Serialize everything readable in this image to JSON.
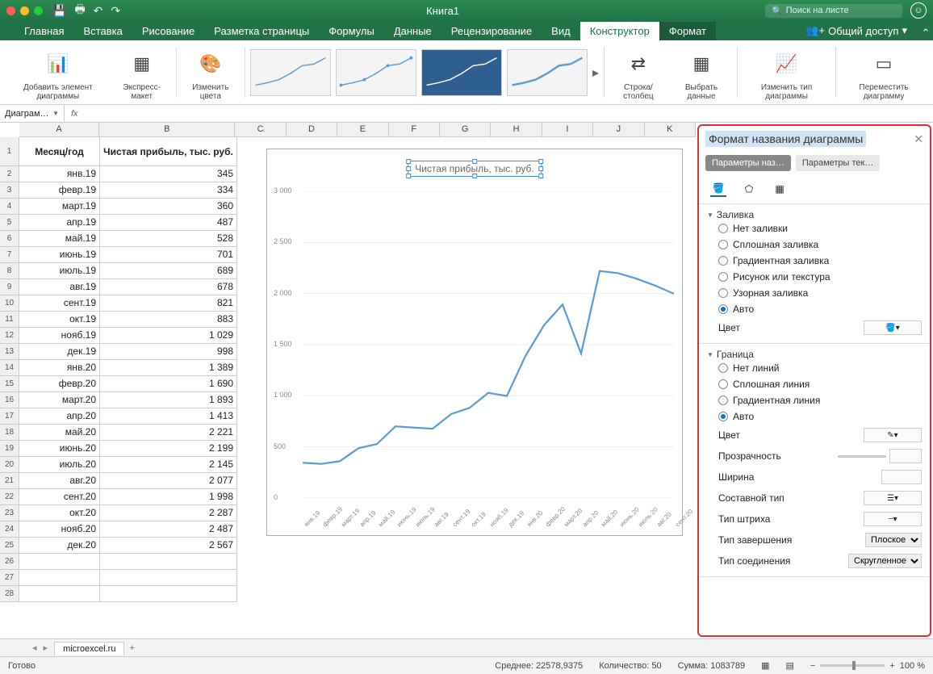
{
  "window": {
    "title": "Книга1",
    "search_placeholder": "Поиск на листе"
  },
  "ribbon_tabs": [
    "Главная",
    "Вставка",
    "Рисование",
    "Разметка страницы",
    "Формулы",
    "Данные",
    "Рецензирование",
    "Вид",
    "Конструктор",
    "Формат"
  ],
  "active_tab": "Конструктор",
  "share_label": "Общий доступ",
  "ribbon_groups": {
    "add_element": "Добавить элемент диаграммы",
    "quick_layout": "Экспресс-макет",
    "change_colors": "Изменить цвета",
    "switch_rowcol": "Строка/столбец",
    "select_data": "Выбрать данные",
    "change_type": "Изменить тип диаграммы",
    "move_chart": "Переместить диаграмму"
  },
  "namebox": "Диаграм…",
  "columns": [
    "A",
    "B",
    "C",
    "D",
    "E",
    "F",
    "G",
    "H",
    "I",
    "J",
    "K"
  ],
  "table": {
    "header_month": "Месяц/год",
    "header_profit": "Чистая прибыль, тыс. руб.",
    "rows": [
      [
        "янв.19",
        "345"
      ],
      [
        "февр.19",
        "334"
      ],
      [
        "март.19",
        "360"
      ],
      [
        "апр.19",
        "487"
      ],
      [
        "май.19",
        "528"
      ],
      [
        "июнь.19",
        "701"
      ],
      [
        "июль.19",
        "689"
      ],
      [
        "авг.19",
        "678"
      ],
      [
        "сент.19",
        "821"
      ],
      [
        "окт.19",
        "883"
      ],
      [
        "нояб.19",
        "1 029"
      ],
      [
        "дек.19",
        "998"
      ],
      [
        "янв.20",
        "1 389"
      ],
      [
        "февр.20",
        "1 690"
      ],
      [
        "март.20",
        "1 893"
      ],
      [
        "апр.20",
        "1 413"
      ],
      [
        "май.20",
        "2 221"
      ],
      [
        "июнь.20",
        "2 199"
      ],
      [
        "июль.20",
        "2 145"
      ],
      [
        "авг.20",
        "2 077"
      ],
      [
        "сент.20",
        "1 998"
      ],
      [
        "окт.20",
        "2 287"
      ],
      [
        "нояб.20",
        "2 487"
      ],
      [
        "дек.20",
        "2 567"
      ]
    ]
  },
  "chart_data": {
    "type": "line",
    "title": "Чистая прибыль, тыс. руб.",
    "xlabel": "",
    "ylabel": "",
    "ylim": [
      0,
      3000
    ],
    "yticks": [
      0,
      500,
      1000,
      1500,
      2000,
      2500,
      3000
    ],
    "categories": [
      "янв.19",
      "февр.19",
      "март.19",
      "апр.19",
      "май.19",
      "июнь.19",
      "июль.19",
      "авг.19",
      "сент.19",
      "окт.19",
      "нояб.19",
      "дек.19",
      "янв.20",
      "февр.20",
      "март.20",
      "апр.20",
      "май.20",
      "июнь.20",
      "июль.20",
      "авг.20",
      "сент.20"
    ],
    "values": [
      345,
      334,
      360,
      487,
      528,
      701,
      689,
      678,
      821,
      883,
      1029,
      998,
      1389,
      1690,
      1893,
      1413,
      2221,
      2199,
      2145,
      2077,
      1998
    ]
  },
  "sidepanel": {
    "title": "Формат названия диаграммы",
    "tab1": "Параметры наз…",
    "tab2": "Параметры тек…",
    "section_fill": "Заливка",
    "fill_options": [
      "Нет заливки",
      "Сплошная заливка",
      "Градиентная заливка",
      "Рисунок или текстура",
      "Узорная заливка",
      "Авто"
    ],
    "fill_selected": "Авто",
    "color_label": "Цвет",
    "section_border": "Граница",
    "border_options": [
      "Нет линий",
      "Сплошная линия",
      "Градиентная линия",
      "Авто"
    ],
    "border_selected": "Авто",
    "transparency": "Прозрачность",
    "width": "Ширина",
    "compound": "Составной тип",
    "dash": "Тип штриха",
    "cap": "Тип завершения",
    "cap_value": "Плоское",
    "join": "Тип соединения",
    "join_value": "Скругленное"
  },
  "sheet": {
    "name": "microexcel.ru"
  },
  "status": {
    "ready": "Готово",
    "avg": "Среднее: 22578,9375",
    "count": "Количество: 50",
    "sum": "Сумма: 1083789",
    "zoom": "100 %"
  }
}
